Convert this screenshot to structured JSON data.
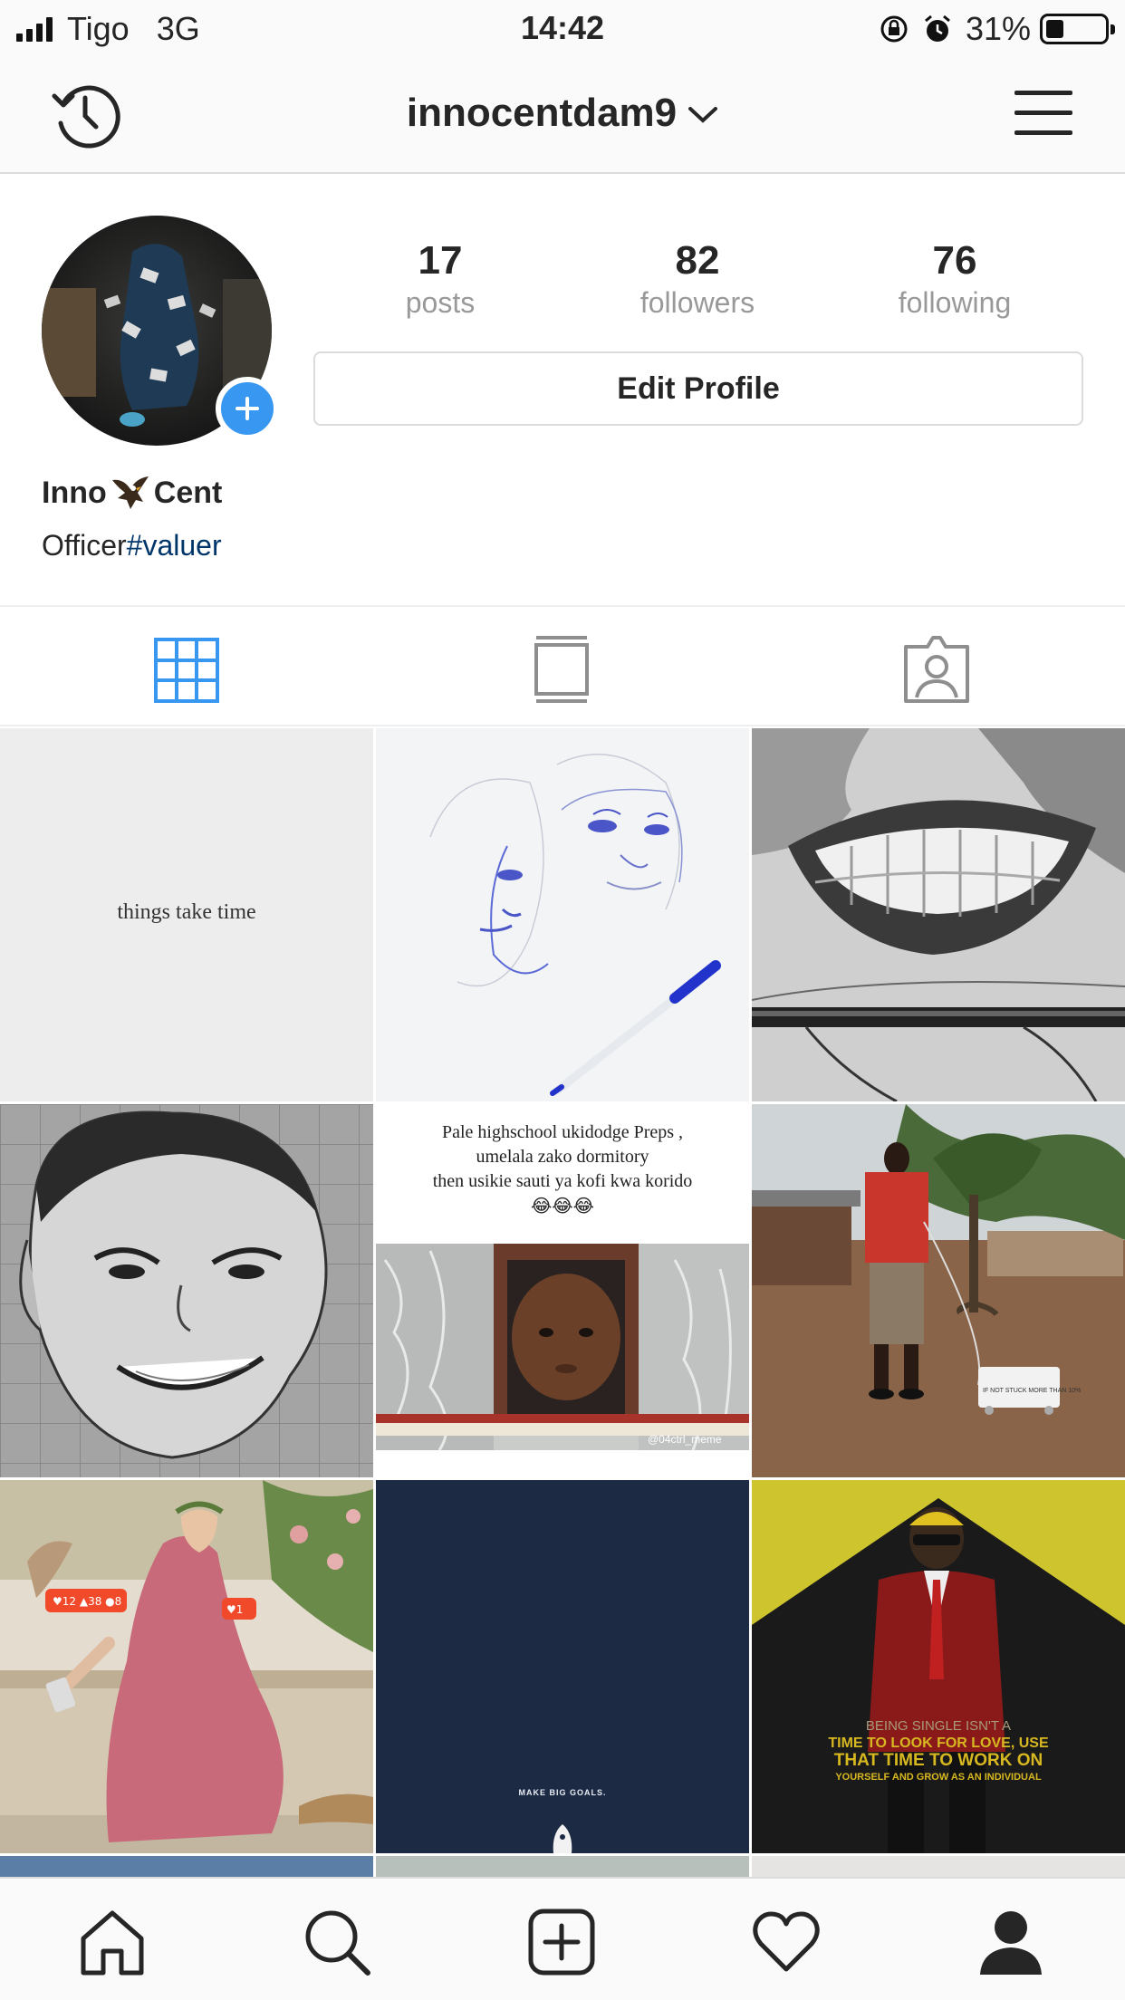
{
  "status_bar": {
    "carrier": "Tigo",
    "network": "3G",
    "time": "14:42",
    "battery_percent": "31%",
    "battery_level": 0.31
  },
  "header": {
    "username": "innocentdam9"
  },
  "profile": {
    "stats": [
      {
        "count": "17",
        "label": "posts"
      },
      {
        "count": "82",
        "label": "followers"
      },
      {
        "count": "76",
        "label": "following"
      }
    ],
    "edit_button": "Edit Profile",
    "name_first": "Inno",
    "name_last": "Cent",
    "bio_text": "Officer",
    "bio_hashtag": "#valuer"
  },
  "posts": [
    {
      "caption": "things take time"
    },
    {
      "caption": ""
    },
    {
      "caption": ""
    },
    {
      "caption": ""
    },
    {
      "caption": "Pale highschool ukidodge Preps ,\numelala zako dormitory\nthen usikie sauti ya kofi kwa korido",
      "emoji": "😂😂😂",
      "watermark": "@04ctrl_meme"
    },
    {
      "caption": "",
      "sign_text": "IF NOT STUCK MORE THAN 10%"
    },
    {
      "caption": "",
      "badge_left": "♥12 ▲38 ●8",
      "badge_right": "♥1"
    },
    {
      "caption": "MAKE BIG GOALS."
    },
    {
      "caption": "",
      "quote_lines": [
        "BEING SINGLE ISN'T A",
        "TIME TO LOOK FOR LOVE, USE",
        "THAT TIME TO WORK ON",
        "YOURSELF AND GROW AS AN INDIVIDUAL"
      ]
    }
  ],
  "icons": {
    "header": [
      "history-icon",
      "chevron-down-icon",
      "menu-icon"
    ],
    "tabs": [
      "grid-icon",
      "feed-icon",
      "tagged-icon"
    ],
    "nav": [
      "home-icon",
      "search-icon",
      "add-post-icon",
      "heart-icon",
      "profile-icon"
    ]
  },
  "colors": {
    "accent": "#3897f0",
    "hashtag": "#003569",
    "active_tab": "#3897f0"
  }
}
